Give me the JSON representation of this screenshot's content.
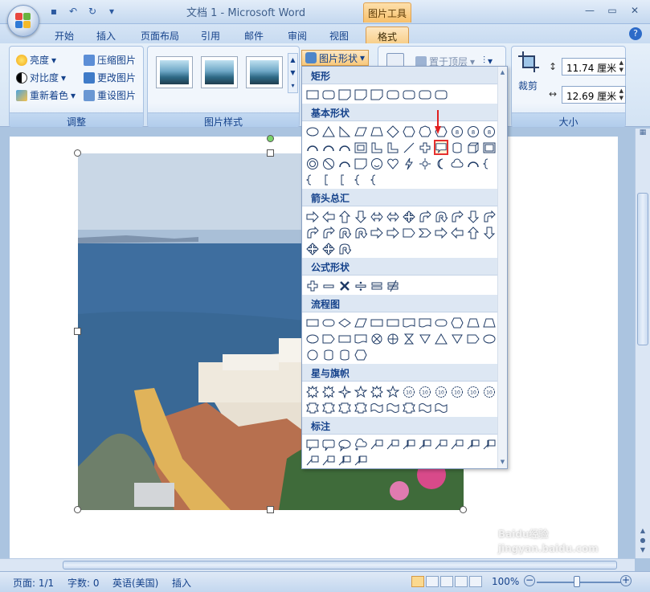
{
  "window": {
    "title": "文档 1 - Microsoft Word",
    "tools_tab": "图片工具"
  },
  "tabs": [
    {
      "label": "开始"
    },
    {
      "label": "插入"
    },
    {
      "label": "页面布局"
    },
    {
      "label": "引用"
    },
    {
      "label": "邮件"
    },
    {
      "label": "审阅"
    },
    {
      "label": "视图"
    },
    {
      "label": "格式"
    }
  ],
  "ribbon": {
    "adjust": {
      "label": "调整",
      "brightness": "亮度",
      "contrast": "对比度",
      "recolor": "重新着色",
      "compress": "压缩图片",
      "change_picture": "更改图片",
      "reset_picture": "重设图片"
    },
    "styles": {
      "label": "图片样式"
    },
    "picture_shape": "图片形状",
    "arrange": {
      "bring_front": "置于顶层"
    },
    "size": {
      "label": "大小",
      "crop": "裁剪",
      "height": "11.74 厘米",
      "width": "12.69 厘米"
    }
  },
  "shape_menu": {
    "sections": [
      {
        "title": "矩形"
      },
      {
        "title": "基本形状"
      },
      {
        "title": "箭头总汇"
      },
      {
        "title": "公式形状"
      },
      {
        "title": "流程图"
      },
      {
        "title": "星与旗帜"
      },
      {
        "title": "标注"
      }
    ]
  },
  "status": {
    "page": "页面: 1/1",
    "words": "字数: 0",
    "language": "英语(美国)",
    "insert": "插入",
    "zoom": "100%"
  },
  "watermark": "Baidu经验 jingyan.baidu.com"
}
